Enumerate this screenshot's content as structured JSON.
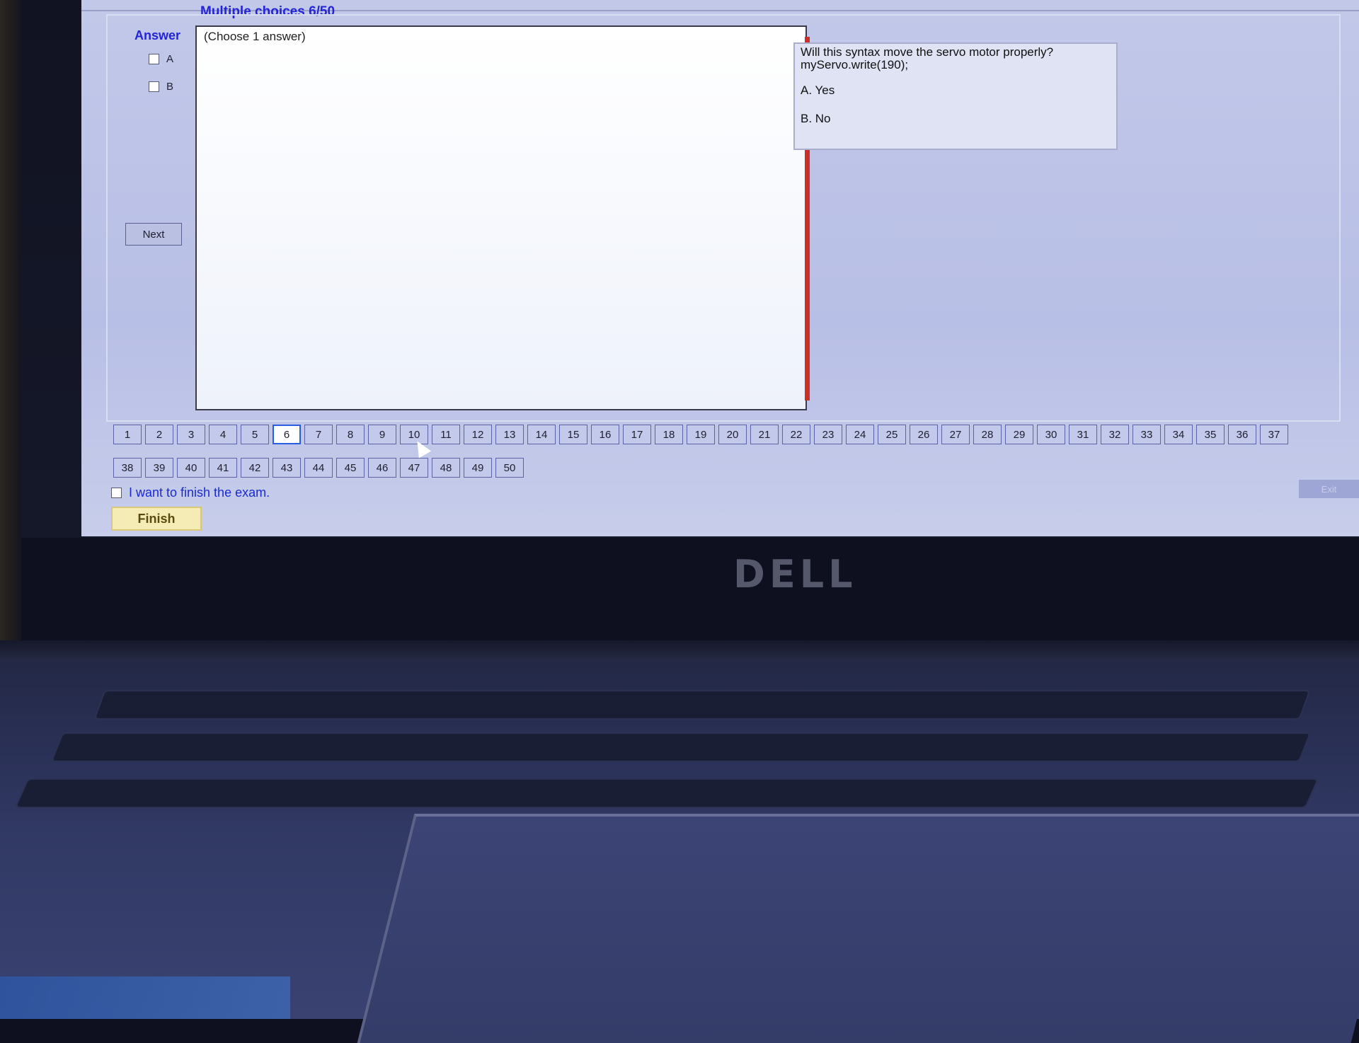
{
  "exam": {
    "title": "Multiple choices 6/50",
    "answer_heading": "Answer",
    "options": [
      {
        "label": "A",
        "checked": false
      },
      {
        "label": "B",
        "checked": false
      }
    ],
    "next_label": "Next",
    "instruction": "(Choose 1 answer)",
    "question": {
      "line1": "Will this syntax move the servo motor properly?",
      "line2": "myServo.write(190);",
      "choice_a": "A.  Yes",
      "choice_b": "B.  No"
    }
  },
  "navigation": {
    "row1": [
      "1",
      "2",
      "3",
      "4",
      "5",
      "6",
      "7",
      "8",
      "9",
      "10",
      "11",
      "12",
      "13",
      "14",
      "15",
      "16",
      "17",
      "18",
      "19",
      "20",
      "21",
      "22",
      "23",
      "24",
      "25",
      "26",
      "27",
      "28",
      "29",
      "30",
      "31",
      "32",
      "33",
      "34",
      "35",
      "36",
      "37"
    ],
    "row2": [
      "38",
      "39",
      "40",
      "41",
      "42",
      "43",
      "44",
      "45",
      "46",
      "47",
      "48",
      "49",
      "50"
    ],
    "current": "6"
  },
  "footer": {
    "finish_checkbox_label": "I want to finish the exam.",
    "finish_label": "Finish",
    "exit_label": "Exit"
  },
  "device": {
    "brand": "DELL"
  }
}
